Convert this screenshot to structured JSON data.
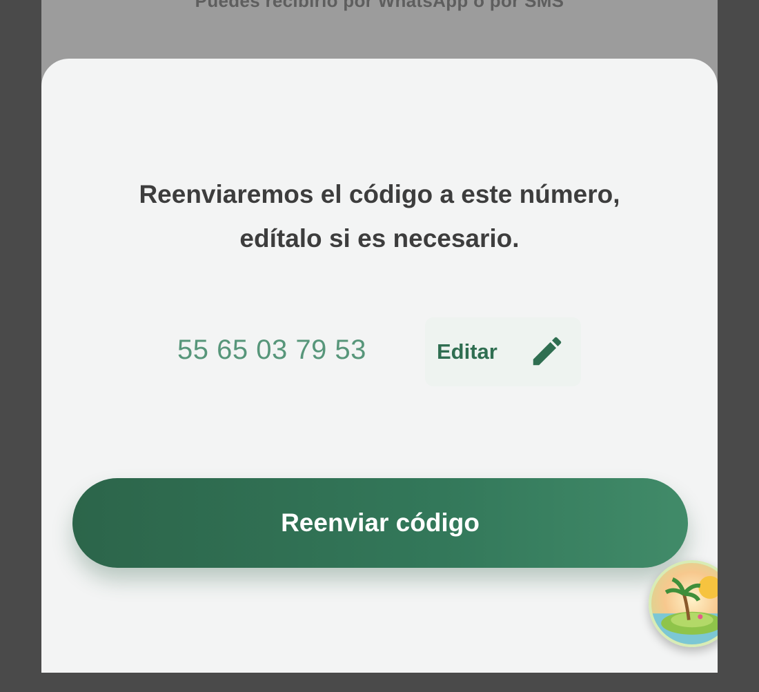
{
  "backdrop": {
    "hint_text": "Puedes recibirlo por WhatsApp o por SMS"
  },
  "sheet": {
    "message_line1": "Reenviaremos el código a este número,",
    "message_line2": "edítalo si es necesario.",
    "phone_number": "55 65 03 79 53",
    "edit_label": "Editar",
    "edit_icon": "pencil-icon",
    "resend_label": "Reenviar código"
  },
  "fab": {
    "icon": "beach-island-icon"
  },
  "colors": {
    "primary": "#2f6e51",
    "number": "#57967a",
    "sheet_bg": "#f3f4f4",
    "overlay": "#9c9c9c"
  }
}
